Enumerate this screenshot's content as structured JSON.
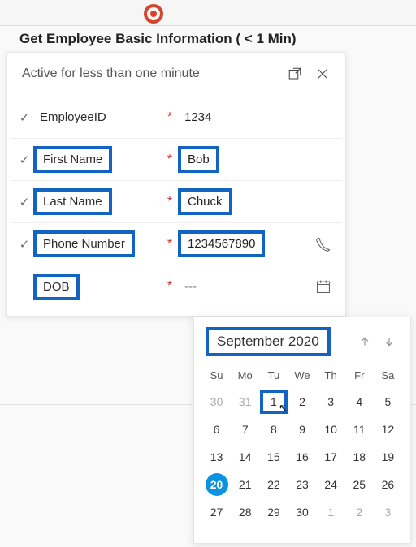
{
  "breadcrumb": {
    "title_prefix": "Get Employee Basic Information",
    "title_suffix": "  ( < 1 Min)"
  },
  "panel": {
    "subtitle": "Active for less than one minute"
  },
  "fields": {
    "employee_id": {
      "label": "EmployeeID",
      "value": "1234",
      "required": "*",
      "checked": true
    },
    "first_name": {
      "label": "First Name",
      "value": "Bob",
      "required": "*",
      "checked": true
    },
    "last_name": {
      "label": "Last Name",
      "value": "Chuck",
      "required": "*",
      "checked": true
    },
    "phone": {
      "label": "Phone Number",
      "value": "1234567890",
      "required": "*",
      "checked": true
    },
    "dob": {
      "label": "DOB",
      "value": "---",
      "required": "*",
      "checked": false
    }
  },
  "calendar": {
    "month_label": "September 2020",
    "dow": [
      "Su",
      "Mo",
      "Tu",
      "We",
      "Th",
      "Fr",
      "Sa"
    ],
    "days": [
      {
        "n": "30",
        "out": true
      },
      {
        "n": "31",
        "out": true
      },
      {
        "n": "1",
        "sel": true
      },
      {
        "n": "2"
      },
      {
        "n": "3"
      },
      {
        "n": "4"
      },
      {
        "n": "5"
      },
      {
        "n": "6"
      },
      {
        "n": "7"
      },
      {
        "n": "8"
      },
      {
        "n": "9"
      },
      {
        "n": "10"
      },
      {
        "n": "11"
      },
      {
        "n": "12"
      },
      {
        "n": "13"
      },
      {
        "n": "14"
      },
      {
        "n": "15"
      },
      {
        "n": "16"
      },
      {
        "n": "17"
      },
      {
        "n": "18"
      },
      {
        "n": "19"
      },
      {
        "n": "20",
        "today": true
      },
      {
        "n": "21"
      },
      {
        "n": "22"
      },
      {
        "n": "23"
      },
      {
        "n": "24"
      },
      {
        "n": "25"
      },
      {
        "n": "26"
      },
      {
        "n": "27"
      },
      {
        "n": "28"
      },
      {
        "n": "29"
      },
      {
        "n": "30"
      },
      {
        "n": "1",
        "out": true
      },
      {
        "n": "2",
        "out": true
      },
      {
        "n": "3",
        "out": true
      }
    ]
  }
}
